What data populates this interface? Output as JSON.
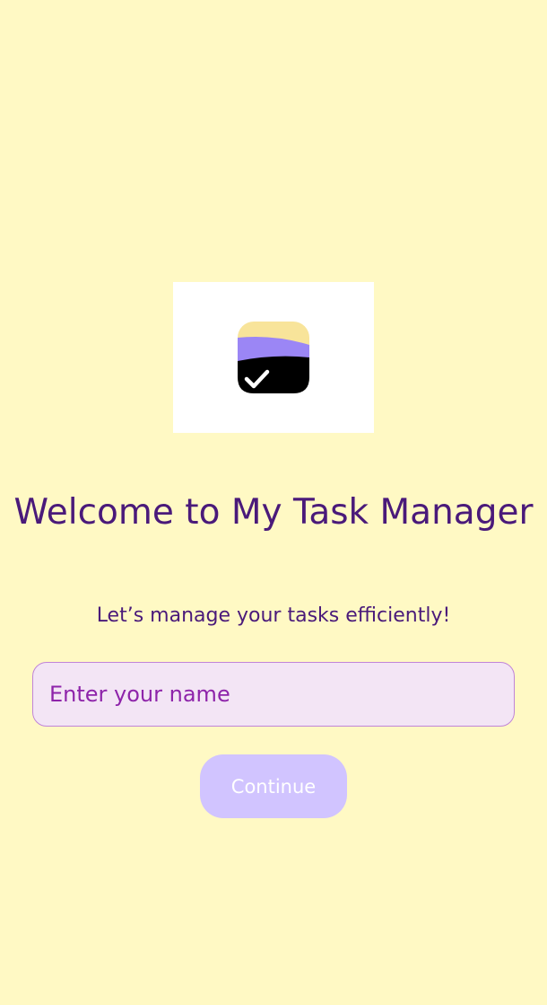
{
  "logo": {
    "icon": "checklist-app-icon",
    "colors": {
      "top_layer": "#F8E49A",
      "middle_layer": "#9B86F5",
      "bottom_layer": "#000000",
      "check": "#FFFFFF"
    }
  },
  "welcome": {
    "title": "Welcome to My Task Manager",
    "subtitle": "Let’s manage your tasks efficiently!"
  },
  "name_field": {
    "placeholder": "Enter your name",
    "value": ""
  },
  "actions": {
    "continue_label": "Continue"
  },
  "colors": {
    "background": "#FFF9C4",
    "title_text": "#4A1A7A",
    "input_background": "#F3E5F5",
    "input_border": "#C084D8",
    "button_background": "#D1C4FF",
    "button_text": "#FFFFFF"
  }
}
